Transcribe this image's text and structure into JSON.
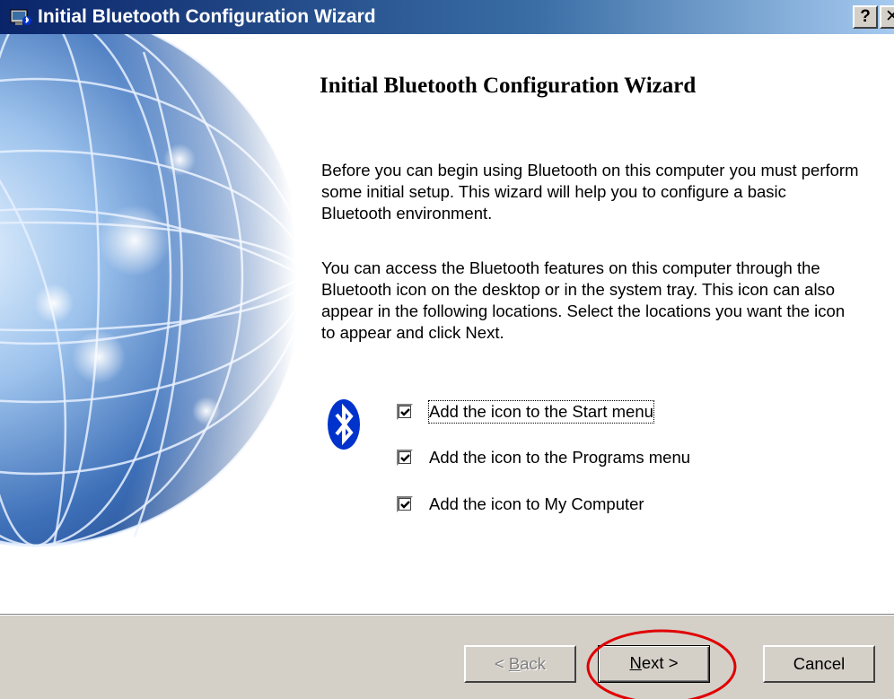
{
  "window": {
    "title": "Initial Bluetooth Configuration Wizard",
    "help_label": "?",
    "close_label": "✕"
  },
  "content": {
    "heading": "Initial Bluetooth Configuration Wizard",
    "paragraph1": "Before you can begin using Bluetooth on this computer you must perform some initial setup. This wizard will help you to configure a basic Bluetooth environment.",
    "paragraph2": "You can access the Bluetooth features on this computer through the Bluetooth icon on the desktop or in the system tray. This icon can also appear in the following locations. Select the locations you want the icon to appear and click Next.",
    "icon": "bluetooth-icon",
    "options": [
      {
        "label": "Add the icon to the Start menu",
        "checked": true
      },
      {
        "label": "Add the icon to the Programs menu",
        "checked": true
      },
      {
        "label": "Add the icon to My Computer",
        "checked": true
      }
    ]
  },
  "buttons": {
    "back_prefix": "< ",
    "back_mnemonic": "B",
    "back_rest": "ack",
    "next_mnemonic": "N",
    "next_rest": "ext >",
    "cancel": "Cancel"
  },
  "colors": {
    "titlebar_start": "#0a246a",
    "titlebar_end": "#a6caf0",
    "face": "#d4d0c8",
    "highlight_circle": "#e00000",
    "bluetooth_blue": "#0033cc"
  }
}
